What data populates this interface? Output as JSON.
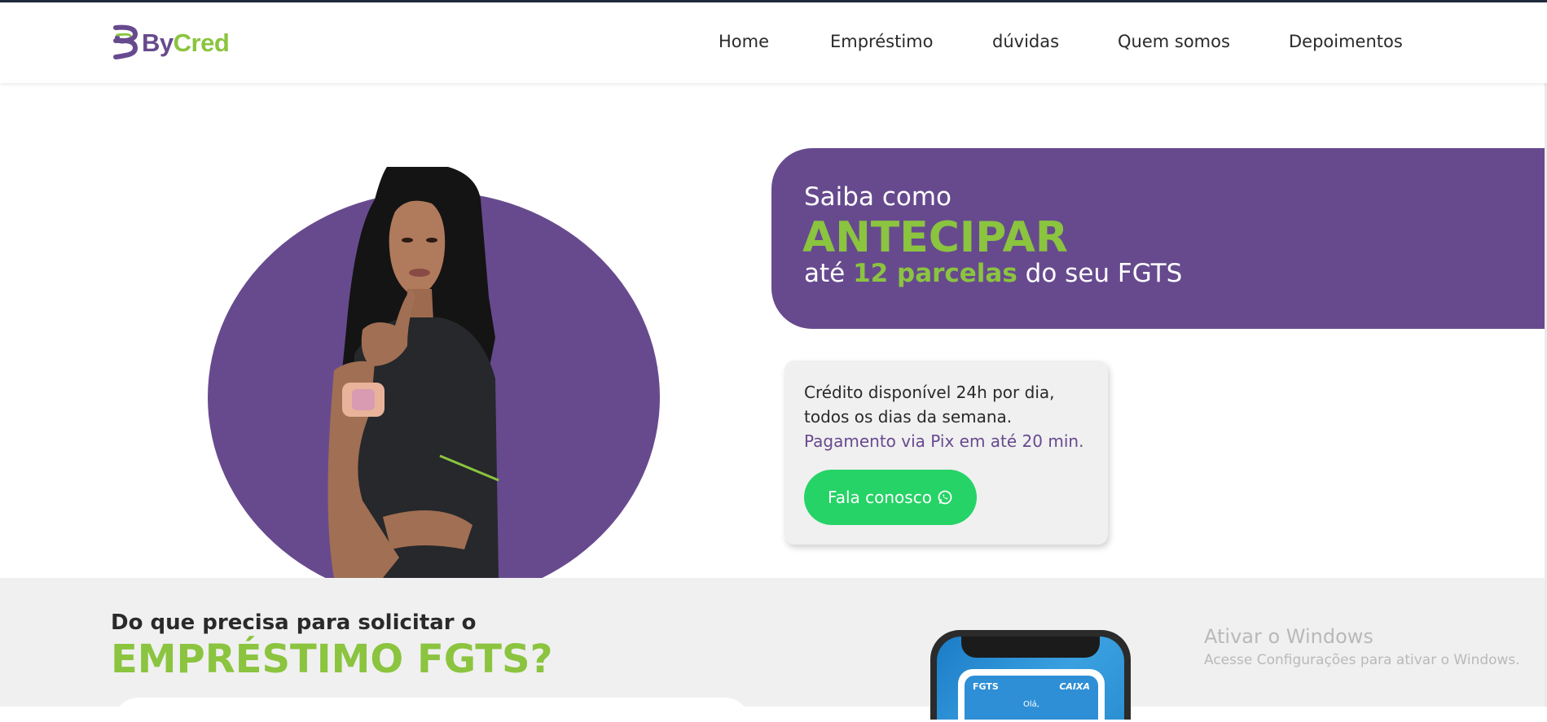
{
  "brand": {
    "logo_by": "By",
    "logo_cred": "Cred",
    "purple": "#674a8e",
    "green": "#8bc43f",
    "whatsapp_green": "#25d366"
  },
  "nav": {
    "items": [
      {
        "label": "Home"
      },
      {
        "label": "Empréstimo"
      },
      {
        "label": "dúvidas"
      },
      {
        "label": "Quem somos"
      },
      {
        "label": "Depoimentos"
      }
    ]
  },
  "hero": {
    "line1": "Saiba como",
    "line2": "ANTECIPAR",
    "line3_prefix": "até ",
    "line3_highlight": "12 parcelas",
    "line3_suffix": " do seu FGTS"
  },
  "info_card": {
    "line1": "Crédito disponível 24h por dia,",
    "line2": "todos os dias da semana.",
    "line3": "Pagamento via Pix em até 20 min.",
    "cta_label": "Fala conosco",
    "cta_icon": "whatsapp-icon"
  },
  "section_two": {
    "title_small": "Do que precisa para solicitar o",
    "title_big": "EMPRÉSTIMO FGTS?"
  },
  "phone": {
    "fgts_label": "FGTS",
    "caixa_label": "CAIXA",
    "hello_text": "Olá,"
  },
  "windows_watermark": {
    "title": "Ativar o Windows",
    "subtitle": "Acesse Configurações para ativar o Windows."
  }
}
